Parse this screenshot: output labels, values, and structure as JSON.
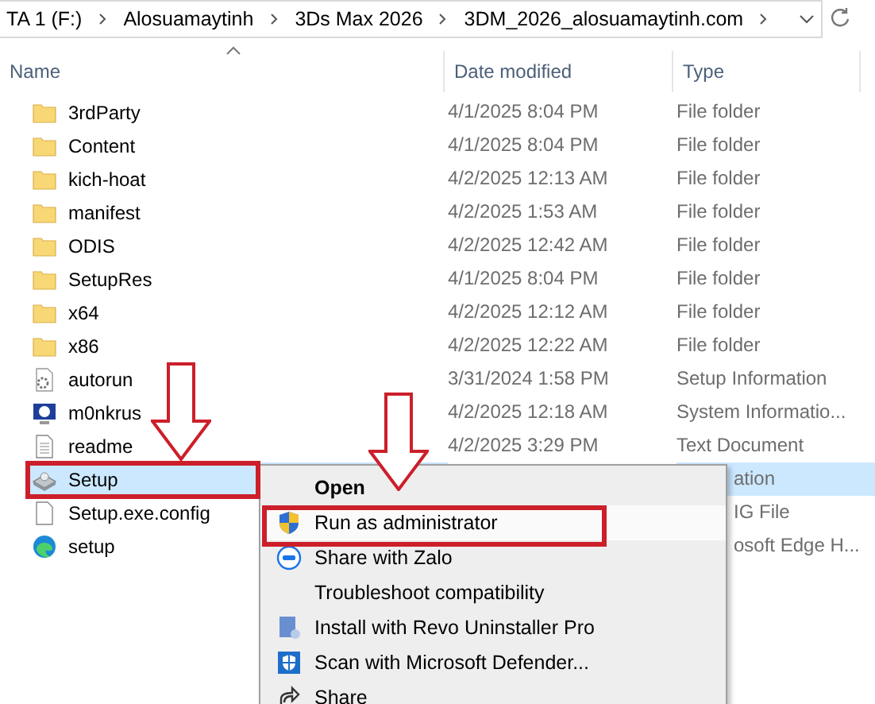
{
  "address_bar": {
    "crumbs": [
      "TA 1 (F:)",
      "Alosuamaytinh",
      "3Ds Max 2026",
      "3DM_2026_alosuamaytinh.com"
    ]
  },
  "columns": [
    "Name",
    "Date modified",
    "Type"
  ],
  "files": [
    {
      "kind": "folder",
      "name": "3rdParty",
      "date": "4/1/2025 8:04 PM",
      "type": "File folder",
      "selected": false
    },
    {
      "kind": "folder",
      "name": "Content",
      "date": "4/1/2025 8:04 PM",
      "type": "File folder",
      "selected": false
    },
    {
      "kind": "folder",
      "name": "kich-hoat",
      "date": "4/2/2025 12:13 AM",
      "type": "File folder",
      "selected": false
    },
    {
      "kind": "folder",
      "name": "manifest",
      "date": "4/2/2025 1:53 AM",
      "type": "File folder",
      "selected": false
    },
    {
      "kind": "folder",
      "name": "ODIS",
      "date": "4/2/2025 12:42 AM",
      "type": "File folder",
      "selected": false
    },
    {
      "kind": "folder",
      "name": "SetupRes",
      "date": "4/1/2025 8:04 PM",
      "type": "File folder",
      "selected": false
    },
    {
      "kind": "folder",
      "name": "x64",
      "date": "4/2/2025 12:12 AM",
      "type": "File folder",
      "selected": false
    },
    {
      "kind": "folder",
      "name": "x86",
      "date": "4/2/2025 12:22 AM",
      "type": "File folder",
      "selected": false
    },
    {
      "kind": "settings",
      "name": "autorun",
      "date": "3/31/2024 1:58 PM",
      "type": "Setup Information",
      "selected": false
    },
    {
      "kind": "sysinfo",
      "name": "m0nkrus",
      "date": "4/2/2025 12:18 AM",
      "type": "System Informatio...",
      "selected": false
    },
    {
      "kind": "text",
      "name": "readme",
      "date": "4/2/2025 3:29 PM",
      "type": "Text Document",
      "selected": false
    },
    {
      "kind": "setup",
      "name": "Setup",
      "type": "ation",
      "selected": true
    },
    {
      "kind": "blank",
      "name": "Setup.exe.config",
      "type": "IG File",
      "selected": false
    },
    {
      "kind": "edge",
      "name": "setup",
      "type": "osoft Edge H...",
      "selected": false
    }
  ],
  "context_menu": [
    {
      "kind": "none",
      "label": "Open",
      "selected": false
    },
    {
      "kind": "shield",
      "label": "Run as administrator",
      "selected": true
    },
    {
      "kind": "zalo",
      "label": "Share with Zalo",
      "selected": false
    },
    {
      "kind": "none",
      "label": "Troubleshoot compatibility",
      "selected": false
    },
    {
      "kind": "revo",
      "label": "Install with Revo Uninstaller Pro",
      "selected": false
    },
    {
      "kind": "defender",
      "label": "Scan with Microsoft Defender...",
      "selected": false
    },
    {
      "kind": "share",
      "label": "Share",
      "selected": false
    }
  ]
}
